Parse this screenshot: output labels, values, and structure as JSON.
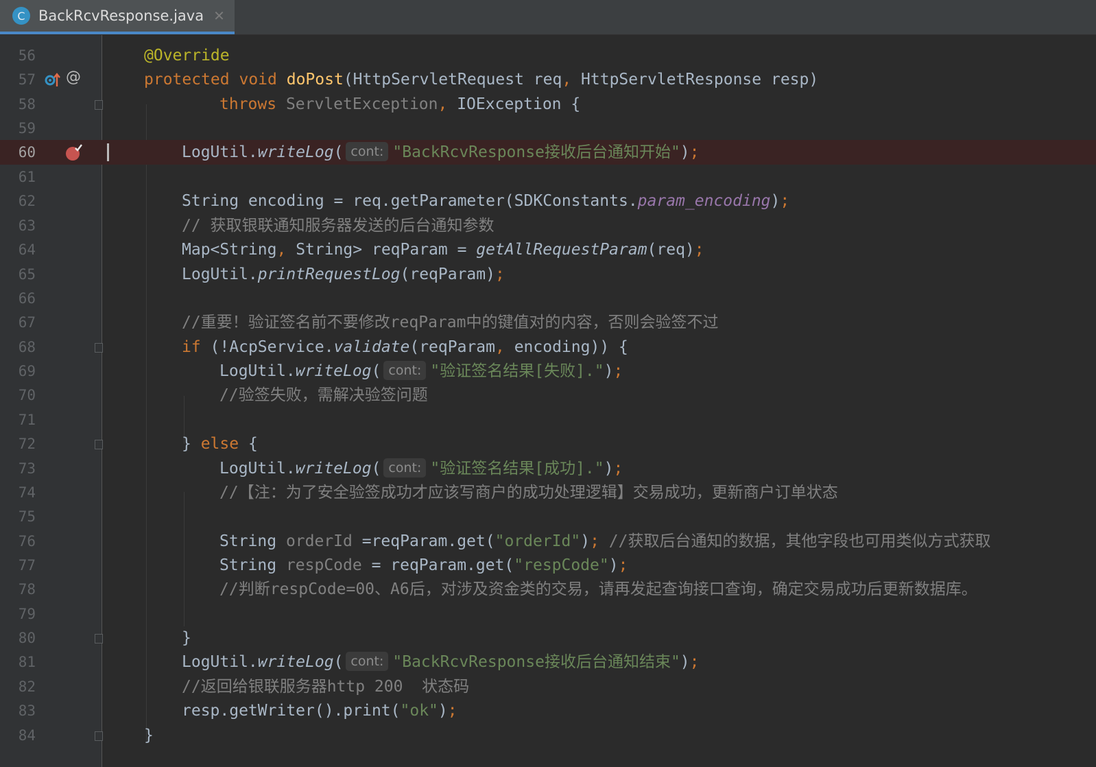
{
  "tab": {
    "icon_letter": "C",
    "file_name": "BackRcvResponse.java",
    "close_glyph": "✕"
  },
  "gutter": {
    "line_numbers": [
      "56",
      "57",
      "58",
      "59",
      "60",
      "61",
      "62",
      "63",
      "64",
      "65",
      "66",
      "67",
      "68",
      "69",
      "70",
      "71",
      "72",
      "73",
      "74",
      "75",
      "76",
      "77",
      "78",
      "79",
      "80",
      "81",
      "82",
      "83",
      "84"
    ],
    "override_mark": "@",
    "current_line": "60",
    "breakpoint_line": "60"
  },
  "code": {
    "l56": "@Override",
    "l57": {
      "k1": "protected",
      "k2": "void",
      "fn": "doPost",
      "rest": "(HttpServletRequest req",
      "c1": ",",
      "rest2": " HttpServletResponse resp)"
    },
    "l58": {
      "kw": "throws",
      "t1": " ServletException",
      "c1": ",",
      "t2": " IOException {"
    },
    "l60": {
      "obj": "LogUtil.",
      "m": "writeLog",
      "open": "(",
      "hint": "cont:",
      "str": "\"BackRcvResponse接收后台通知开始\"",
      "close": ")",
      "semi": ";"
    },
    "l62": {
      "t1": "String encoding = req.getParameter(SDKConstants.",
      "field": "param_encoding",
      "close": ")",
      "semi": ";"
    },
    "l63": "// 获取银联通知服务器发送的后台通知参数",
    "l64": {
      "t1": "Map<String",
      "c1": ",",
      "t2": " String> reqParam = ",
      "m": "getAllRequestParam",
      "t3": "(req)",
      "semi": ";"
    },
    "l65": {
      "obj": "LogUtil.",
      "m": "printRequestLog",
      "t": "(reqParam)",
      "semi": ";"
    },
    "l67": "//重要！验证签名前不要修改reqParam中的键值对的内容，否则会验签不过",
    "l68": {
      "kw": "if",
      "t1": " (!AcpService.",
      "m": "validate",
      "t2": "(reqParam",
      "c1": ",",
      "t3": " encoding)) {"
    },
    "l69": {
      "obj": "LogUtil.",
      "m": "writeLog",
      "open": "(",
      "hint": "cont:",
      "str": "\"验证签名结果[失败].\"",
      "close": ")",
      "semi": ";"
    },
    "l70": "//验签失败，需解决验签问题",
    "l72": {
      "t1": "} ",
      "kw": "else",
      "t2": " {"
    },
    "l73": {
      "obj": "LogUtil.",
      "m": "writeLog",
      "open": "(",
      "hint": "cont:",
      "str": "\"验证签名结果[成功].\"",
      "close": ")",
      "semi": ";"
    },
    "l74": "//【注：为了安全验签成功才应该写商户的成功处理逻辑】交易成功，更新商户订单状态",
    "l76": {
      "t1": "String ",
      "var": "orderId",
      "t2": " =reqParam.get(",
      "str": "\"orderId\"",
      "t3": ")",
      "semi": ";",
      "cmt": " //获取后台通知的数据，其他字段也可用类似方式获取"
    },
    "l77": {
      "t1": "String ",
      "var": "respCode",
      "t2": " = reqParam.get(",
      "str": "\"respCode\"",
      "t3": ")",
      "semi": ";"
    },
    "l78": "//判断respCode=00、A6后，对涉及资金类的交易，请再发起查询接口查询，确定交易成功后更新数据库。",
    "l80": "}",
    "l81": {
      "obj": "LogUtil.",
      "m": "writeLog",
      "open": "(",
      "hint": "cont:",
      "str": "\"BackRcvResponse接收后台通知结束\"",
      "close": ")",
      "semi": ";"
    },
    "l82": "//返回给银联服务器http 200  状态码",
    "l83": {
      "t1": "resp.getWriter().print(",
      "str": "\"ok\"",
      "t2": ")",
      "semi": ";"
    },
    "l84": "}"
  },
  "colors": {
    "background": "#2b2b2b",
    "gutter": "#313335",
    "keyword": "#cc7832",
    "string": "#6a8759",
    "comment": "#808080",
    "method": "#ffc66d",
    "annotation": "#bbb529",
    "field": "#9876aa",
    "breakpoint": "#c75450",
    "tab_underline": "#4a88c7"
  }
}
